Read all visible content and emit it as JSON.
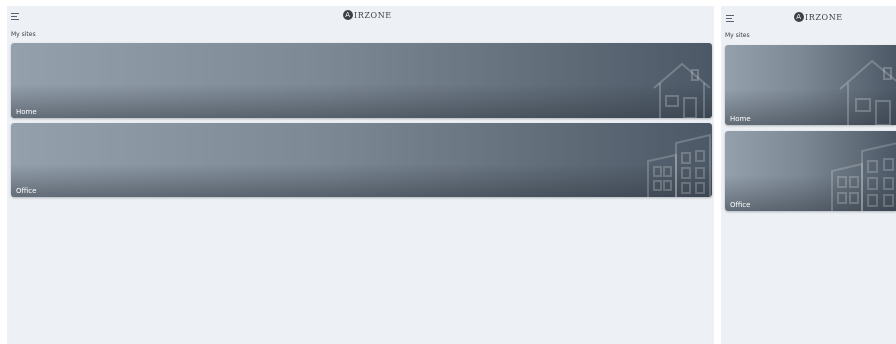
{
  "header": {
    "menu_icon": "hamburger-menu-icon",
    "brand_mark": "A",
    "brand_text": "IRZONE"
  },
  "sites": {
    "title": "My sites",
    "items": [
      {
        "label": "Home",
        "icon": "house-icon"
      },
      {
        "label": "Office",
        "icon": "office-building-icon"
      }
    ]
  },
  "colors": {
    "background": "#edf1f5",
    "card_left": "#94a0ac",
    "card_right": "#4c5866",
    "text": "#3c4048"
  }
}
